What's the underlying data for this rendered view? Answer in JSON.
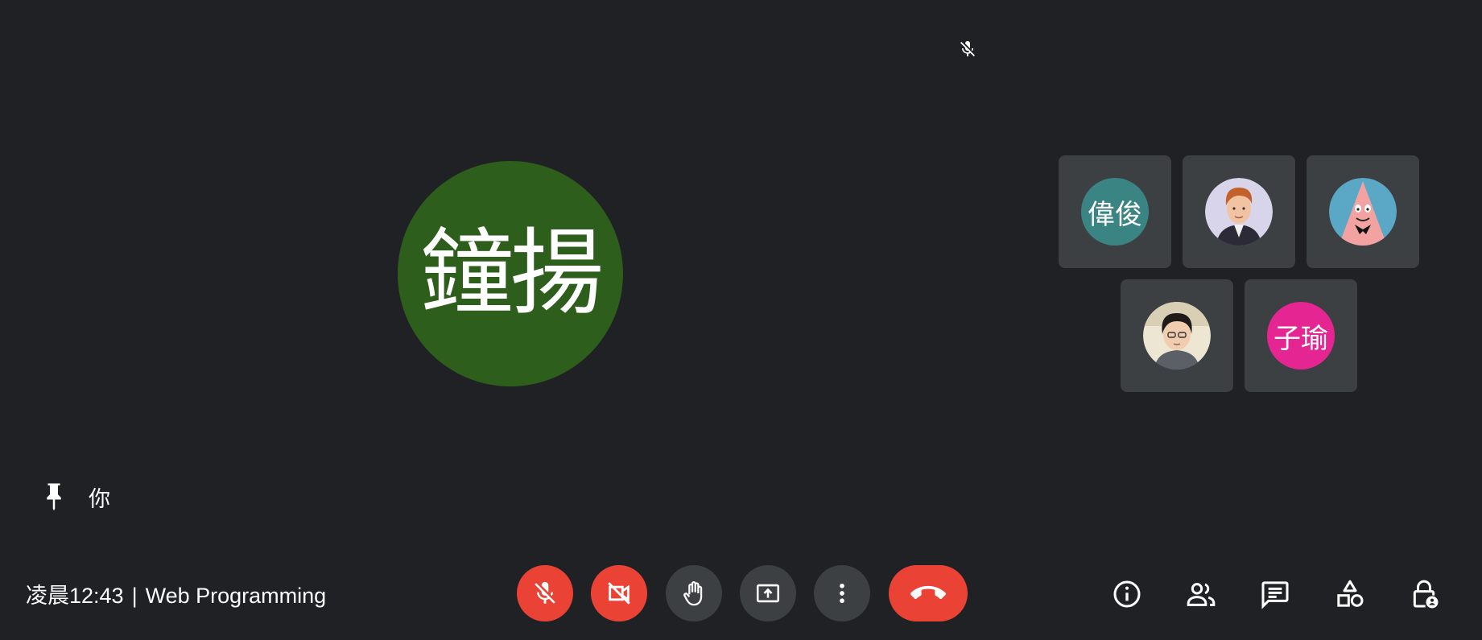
{
  "main_participant": {
    "initials": "鐘揚",
    "avatar_color": "#2d5e1c",
    "label": "你"
  },
  "participants": [
    {
      "type": "initials",
      "text": "偉俊",
      "color": "#3b8484"
    },
    {
      "type": "photo",
      "icon": "rick-avatar-photo",
      "color": "#d6d3e6"
    },
    {
      "type": "photo",
      "icon": "patrick-avatar-photo",
      "color": "#5aa7c6"
    },
    {
      "type": "photo",
      "icon": "boy-avatar-photo",
      "color": "#e9e2cf"
    },
    {
      "type": "initials",
      "text": "子瑜",
      "color": "#e52592"
    }
  ],
  "meeting": {
    "time": "凌晨12:43",
    "separator": "|",
    "title": "Web Programming"
  },
  "controls": [
    {
      "name": "mic-toggle",
      "icon": "mic-off-icon",
      "state": "off",
      "color": "#ea4335"
    },
    {
      "name": "camera-toggle",
      "icon": "videocam-off-icon",
      "state": "off",
      "color": "#ea4335"
    },
    {
      "name": "raise-hand",
      "icon": "hand-icon",
      "color": "#3c4043"
    },
    {
      "name": "present",
      "icon": "present-screen-icon",
      "color": "#3c4043"
    },
    {
      "name": "more-options",
      "icon": "more-vert-icon",
      "color": "#3c4043"
    },
    {
      "name": "leave-call",
      "icon": "call-end-icon",
      "color": "#ea4335"
    }
  ],
  "side_buttons": [
    {
      "name": "meeting-details",
      "icon": "info-icon"
    },
    {
      "name": "people",
      "icon": "people-icon"
    },
    {
      "name": "chat",
      "icon": "chat-icon"
    },
    {
      "name": "activities",
      "icon": "shapes-icon"
    },
    {
      "name": "host-controls",
      "icon": "lock-person-icon"
    }
  ]
}
